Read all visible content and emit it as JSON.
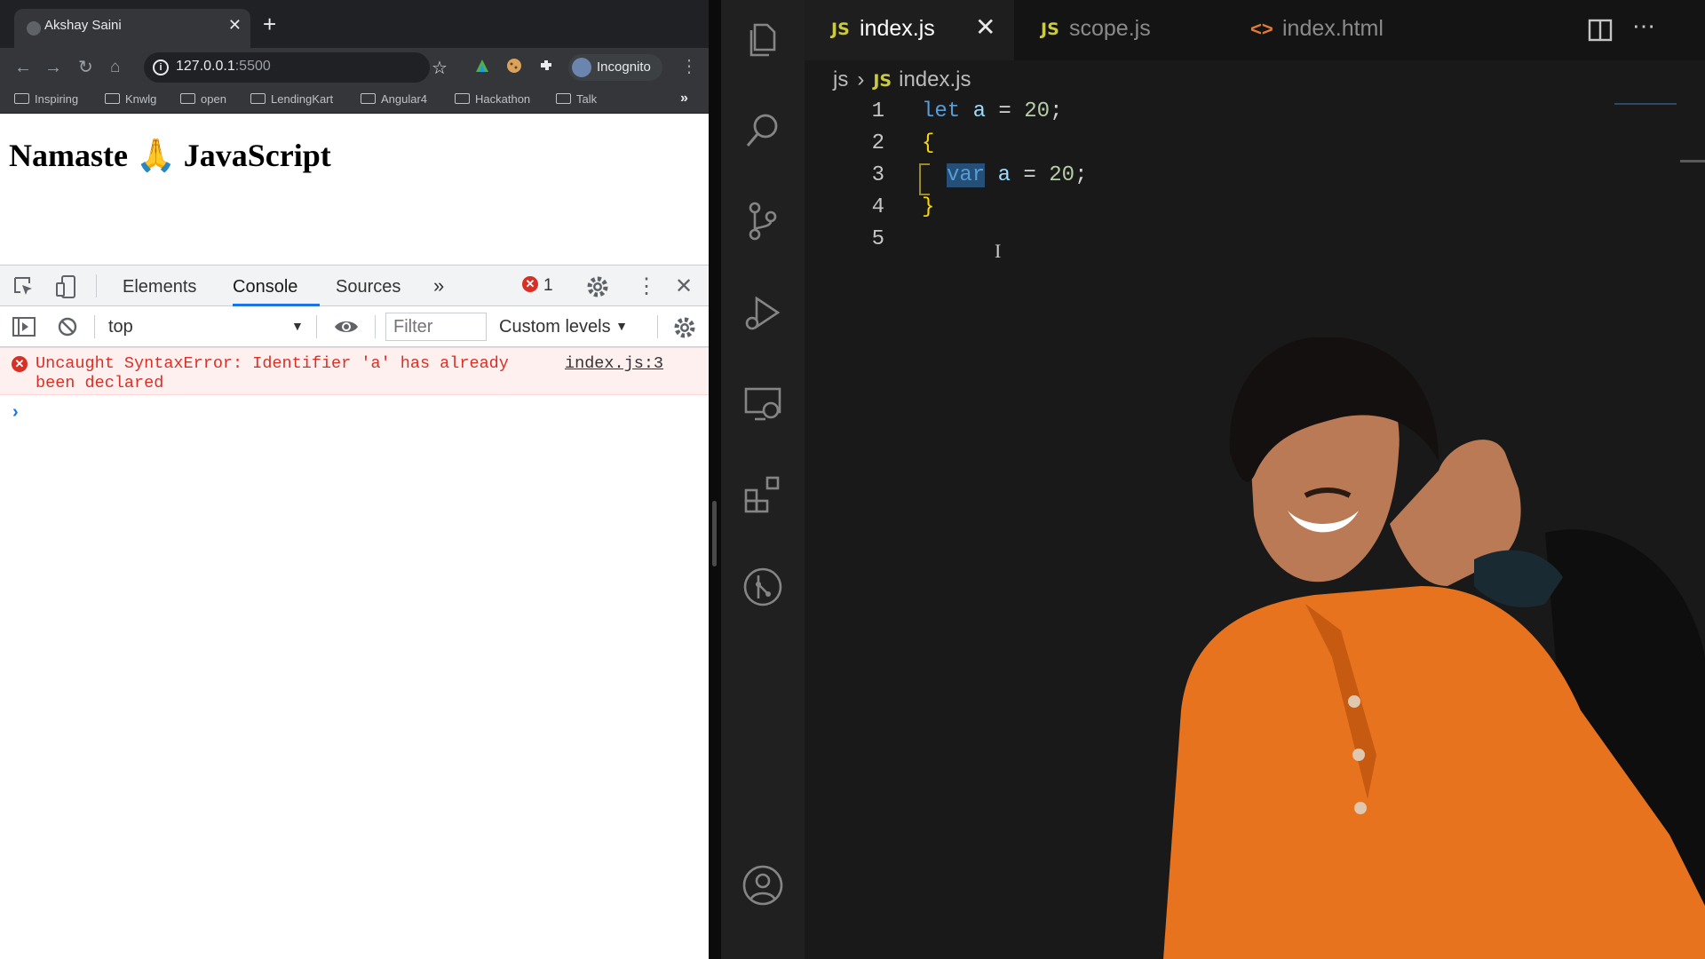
{
  "browser": {
    "tab_title": "Akshay Saini",
    "url_host": "127.0.0.1",
    "url_port": ":5500",
    "profile_label": "Incognito",
    "bookmarks": [
      "Inspiring",
      "Knwlg",
      "open",
      "LendingKart",
      "Angular4",
      "Hackathon",
      "Talk"
    ],
    "page_heading": "Namaste 🙏 JavaScript",
    "devtools": {
      "tabs": [
        "Elements",
        "Console",
        "Sources"
      ],
      "active_tab": "Console",
      "error_count": "1",
      "context": "top",
      "filter_placeholder": "Filter",
      "levels": "Custom levels",
      "error_message": "Uncaught SyntaxError: Identifier 'a' has already been declared",
      "error_source": "index.js:3"
    }
  },
  "vscode": {
    "tabs": [
      {
        "label": "index.js",
        "type": "js",
        "active": true
      },
      {
        "label": "scope.js",
        "type": "js",
        "active": false
      },
      {
        "label": "index.html",
        "type": "html",
        "active": false
      }
    ],
    "breadcrumb": [
      "js",
      "index.js"
    ],
    "js_badge": "JS",
    "line_numbers": [
      "1",
      "2",
      "3",
      "4",
      "5"
    ],
    "code": {
      "line1": {
        "kw": "let",
        "id": "a",
        "op": " = ",
        "num": "20",
        "end": ";"
      },
      "line2": {
        "brace": "{"
      },
      "line3": {
        "kw": "var",
        "id": "a",
        "op": " = ",
        "num": "20",
        "end": ";"
      },
      "line4": {
        "brace": "}"
      }
    }
  },
  "colors": {
    "vscode_bg": "#191919",
    "activity_bg": "#202020",
    "keyword": "#569cd6",
    "number": "#b5cea8",
    "error_red": "#d93025",
    "shirt_orange": "#e8731f"
  },
  "icons": [
    "explorer-icon",
    "search-icon",
    "source-control-icon",
    "run-debug-icon",
    "remote-explorer-icon",
    "extensions-icon",
    "git-graph-icon",
    "account-icon"
  ]
}
